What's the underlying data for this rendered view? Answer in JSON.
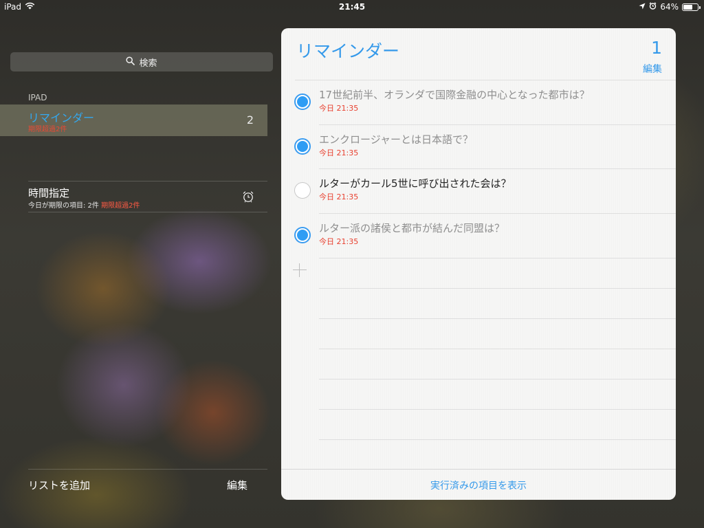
{
  "status_bar": {
    "device": "iPad",
    "time": "21:45",
    "battery_text": "64%",
    "battery_level": 0.64
  },
  "sidebar": {
    "search_placeholder": "検索",
    "section_header": "IPAD",
    "lists": [
      {
        "title": "リマインダー",
        "subtitle": "期限超過2件",
        "count": "2",
        "selected": true
      }
    ],
    "scheduled": {
      "title": "時間指定",
      "subtitle_prefix": "今日が期限の項目: 2件",
      "subtitle_overdue": "期限超過2件"
    },
    "add_list_label": "リストを追加",
    "edit_label": "編集"
  },
  "reminder_panel": {
    "title": "リマインダー",
    "count": "1",
    "edit_label": "編集",
    "tasks": [
      {
        "text": "17世紀前半、オランダで国際金融の中心となった都市は？",
        "due": "今日 21:35",
        "completed": true
      },
      {
        "text": "エンクロージャーとは日本語で？",
        "due": "今日 21:35",
        "completed": true
      },
      {
        "text": "ルターがカール5世に呼び出された会は？",
        "due": "今日 21:35",
        "completed": false
      },
      {
        "text": "ルター派の諸侯と都市が結んだ同盟は？",
        "due": "今日 21:35",
        "completed": true
      }
    ],
    "show_completed_label": "実行済みの項目を表示"
  },
  "colors": {
    "accent_blue": "#3499ea",
    "overdue_red": "#e8402f",
    "check_blue": "#2f9df4"
  },
  "icons": {
    "wifi": "wifi-icon",
    "location": "location-arrow-icon",
    "alarm": "alarm-clock-icon",
    "search": "search-icon",
    "battery": "battery-icon",
    "add": "plus-icon"
  }
}
